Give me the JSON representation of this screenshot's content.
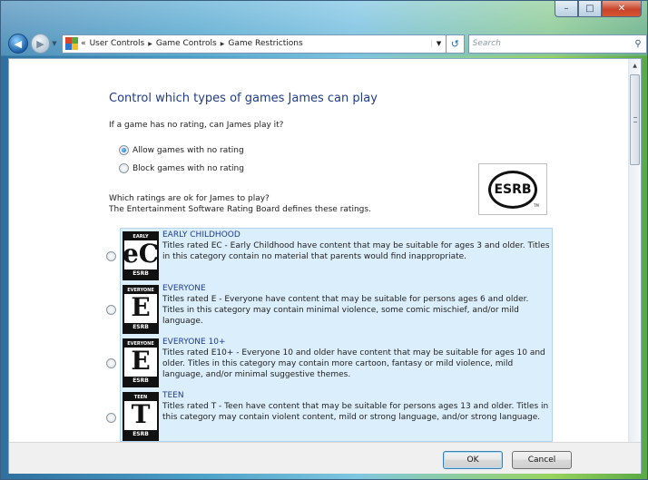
{
  "window": {
    "minimize_icon": "minimize-icon",
    "maximize_icon": "maximize-icon",
    "close_icon": "close-icon"
  },
  "nav": {
    "back_icon": "back-arrow-icon",
    "forward_icon": "forward-arrow-icon",
    "overflow": "«",
    "breadcrumbs": [
      "User Controls",
      "Game Controls",
      "Game Restrictions"
    ],
    "search_placeholder": "Search"
  },
  "content": {
    "heading": "Control which types of games James can play",
    "unrated_question": "If a game has no rating, can James play it?",
    "options": {
      "allow": "Allow games with no rating",
      "block": "Block games with no rating",
      "selected": "allow"
    },
    "ratings_question_line1": "Which ratings are ok for James to play?",
    "ratings_question_line2": "The Entertainment Software Rating Board defines these ratings.",
    "logo_text": "ESRB",
    "logo_tm": "TM",
    "ratings": [
      {
        "icon_letter": "eC",
        "icon_top": "EARLY CHILDHOOD",
        "icon_bottom": "ESRB",
        "title": "EARLY CHILDHOOD",
        "desc": "Titles rated EC - Early Childhood have content that may be suitable for ages 3 and older. Titles in this category contain no material that parents would find inappropriate."
      },
      {
        "icon_letter": "E",
        "icon_top": "EVERYONE",
        "icon_bottom": "ESRB",
        "title": "EVERYONE",
        "desc": "Titles rated E - Everyone have content that may be suitable for persons ages 6 and older. Titles in this category may contain minimal violence, some comic mischief, and/or mild language."
      },
      {
        "icon_letter": "E",
        "icon_top": "EVERYONE 10+",
        "icon_bottom": "ESRB",
        "title": "EVERYONE 10+",
        "desc": "Titles rated E10+ - Everyone 10 and older have content that may be suitable for ages 10 and older. Titles in this category may contain more cartoon, fantasy or mild violence, mild language, and/or minimal suggestive themes."
      },
      {
        "icon_letter": "T",
        "icon_top": "TEEN",
        "icon_bottom": "ESRB",
        "title": "TEEN",
        "desc": "Titles rated T - Teen have content that may be suitable for persons ages 13 and older. Titles in this category may contain violent content, mild or strong language, and/or strong language."
      }
    ]
  },
  "footer": {
    "ok": "OK",
    "cancel": "Cancel"
  }
}
